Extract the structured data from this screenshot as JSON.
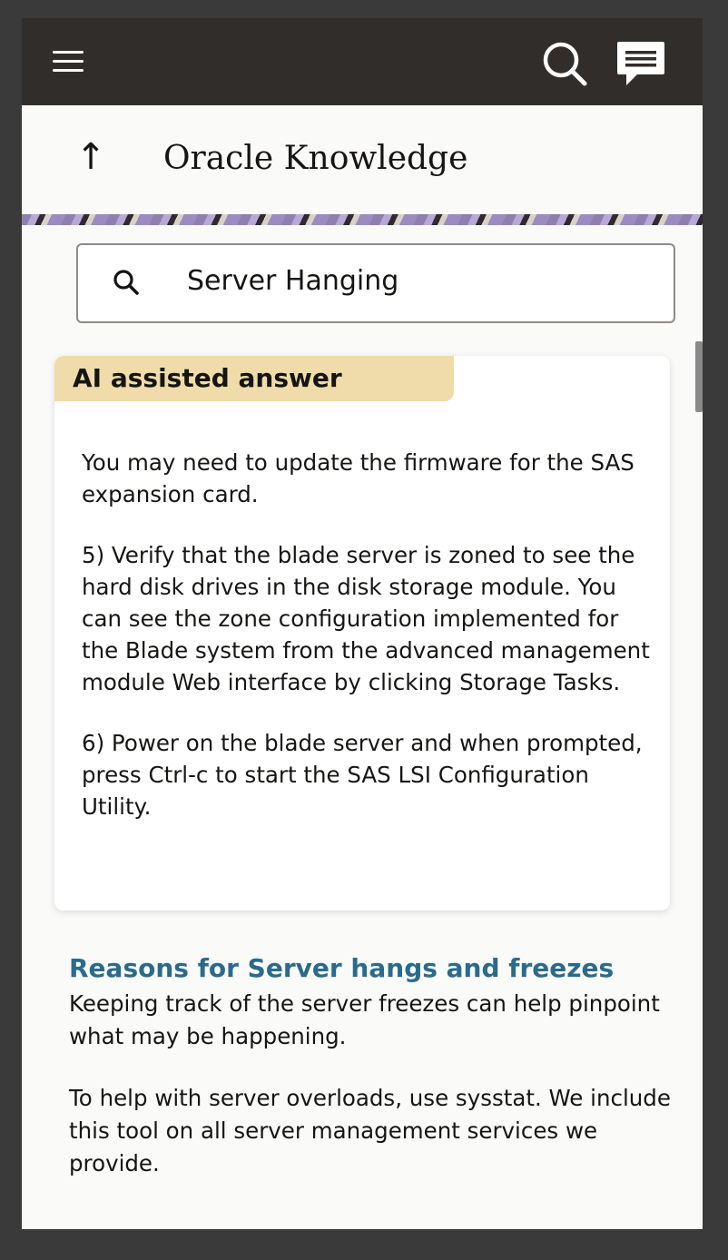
{
  "header": {
    "title": "Oracle Knowledge"
  },
  "search": {
    "query": "Server Hanging"
  },
  "ai_answer": {
    "badge": "AI assisted answer",
    "paragraphs": [
      "You may need to update the firmware for the SAS expansion card.",
      "5) Verify that the blade server is zoned to see the hard disk drives in the disk storage module. You can see the zone configuration implemented for the Blade system from the advanced management module Web interface by clicking Storage Tasks.",
      "6) Power on the blade server and when prompted, press Ctrl-c to start the SAS LSI Configuration Utility."
    ]
  },
  "results": [
    {
      "title": "Reasons for Server hangs and freezes",
      "paragraphs": [
        "Keeping track of the server freezes can help pinpoint what may be happening.",
        "To help with server overloads, use sysstat. We include this tool on all server management services we provide."
      ]
    }
  ],
  "icons": {
    "menu": "hamburger-icon",
    "search": "search-icon",
    "chat": "chat-icon",
    "back": "up-arrow-icon"
  },
  "colors": {
    "topbar": "#312d2a",
    "badge": "#f0dcaa",
    "link": "#2b6b8a"
  }
}
